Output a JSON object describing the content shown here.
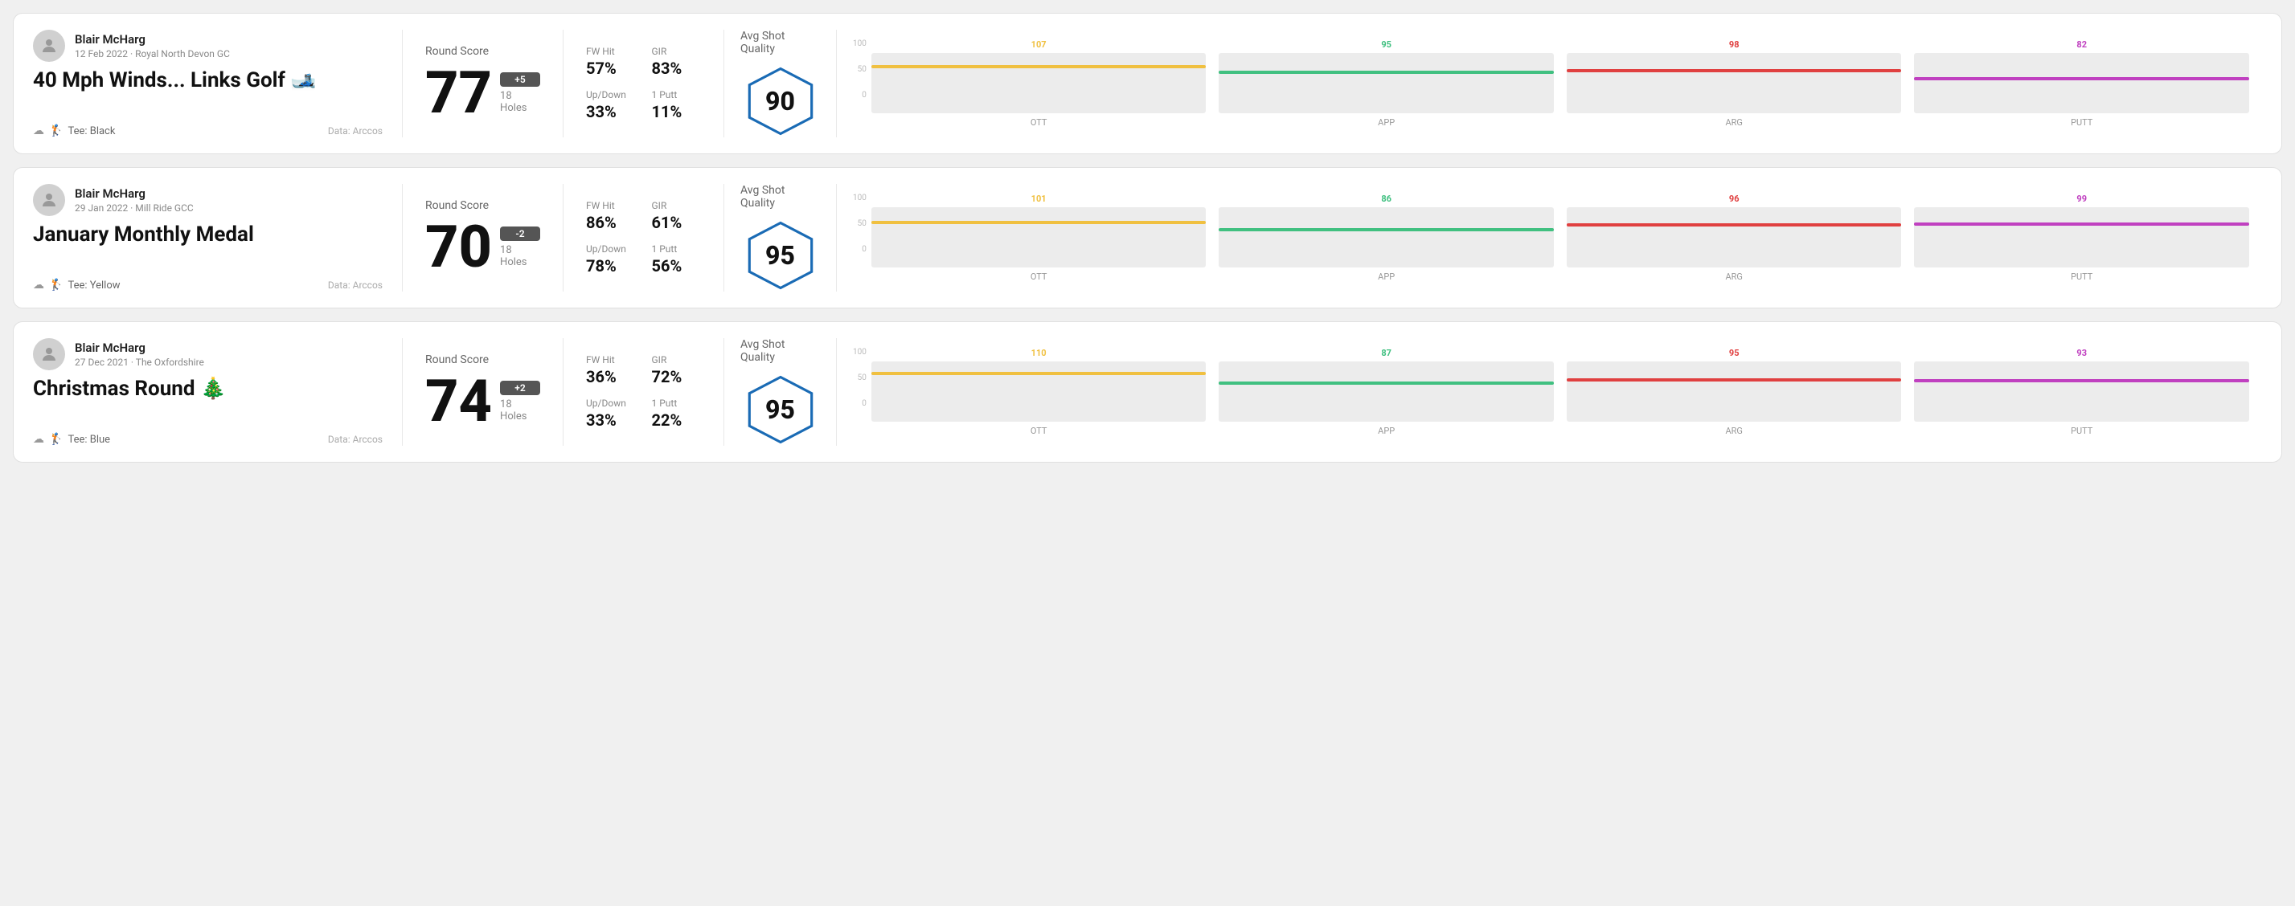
{
  "rounds": [
    {
      "id": "round-1",
      "user": {
        "name": "Blair McHarg",
        "date": "12 Feb 2022",
        "course": "Royal North Devon GC"
      },
      "title": "40 Mph Winds... Links Golf 🎿",
      "tee": "Black",
      "data_source": "Data: Arccos",
      "score": {
        "value": "77",
        "badge": "+5",
        "holes": "18 Holes"
      },
      "stats": {
        "fw_hit_label": "FW Hit",
        "fw_hit_value": "57%",
        "gir_label": "GIR",
        "gir_value": "83%",
        "updown_label": "Up/Down",
        "updown_value": "33%",
        "oneputt_label": "1 Putt",
        "oneputt_value": "11%"
      },
      "quality": {
        "label": "Avg Shot Quality",
        "score": "90"
      },
      "chart": {
        "y_labels": [
          "100",
          "50",
          "0"
        ],
        "columns": [
          {
            "label": "OTT",
            "value": 107,
            "value_label": "107",
            "color": "#f0c040",
            "bar_pct": 75
          },
          {
            "label": "APP",
            "value": 95,
            "value_label": "95",
            "color": "#40c080",
            "bar_pct": 65
          },
          {
            "label": "ARG",
            "value": 98,
            "value_label": "98",
            "color": "#e04040",
            "bar_pct": 68
          },
          {
            "label": "PUTT",
            "value": 82,
            "value_label": "82",
            "color": "#c040c0",
            "bar_pct": 55
          }
        ]
      }
    },
    {
      "id": "round-2",
      "user": {
        "name": "Blair McHarg",
        "date": "29 Jan 2022",
        "course": "Mill Ride GCC"
      },
      "title": "January Monthly Medal",
      "tee": "Yellow",
      "data_source": "Data: Arccos",
      "score": {
        "value": "70",
        "badge": "-2",
        "holes": "18 Holes"
      },
      "stats": {
        "fw_hit_label": "FW Hit",
        "fw_hit_value": "86%",
        "gir_label": "GIR",
        "gir_value": "61%",
        "updown_label": "Up/Down",
        "updown_value": "78%",
        "oneputt_label": "1 Putt",
        "oneputt_value": "56%"
      },
      "quality": {
        "label": "Avg Shot Quality",
        "score": "95"
      },
      "chart": {
        "y_labels": [
          "100",
          "50",
          "0"
        ],
        "columns": [
          {
            "label": "OTT",
            "value": 101,
            "value_label": "101",
            "color": "#f0c040",
            "bar_pct": 72
          },
          {
            "label": "APP",
            "value": 86,
            "value_label": "86",
            "color": "#40c080",
            "bar_pct": 60
          },
          {
            "label": "ARG",
            "value": 96,
            "value_label": "96",
            "color": "#e04040",
            "bar_pct": 68
          },
          {
            "label": "PUTT",
            "value": 99,
            "value_label": "99",
            "color": "#c040c0",
            "bar_pct": 70
          }
        ]
      }
    },
    {
      "id": "round-3",
      "user": {
        "name": "Blair McHarg",
        "date": "27 Dec 2021",
        "course": "The Oxfordshire"
      },
      "title": "Christmas Round 🎄",
      "tee": "Blue",
      "data_source": "Data: Arccos",
      "score": {
        "value": "74",
        "badge": "+2",
        "holes": "18 Holes"
      },
      "stats": {
        "fw_hit_label": "FW Hit",
        "fw_hit_value": "36%",
        "gir_label": "GIR",
        "gir_value": "72%",
        "updown_label": "Up/Down",
        "updown_value": "33%",
        "oneputt_label": "1 Putt",
        "oneputt_value": "22%"
      },
      "quality": {
        "label": "Avg Shot Quality",
        "score": "95"
      },
      "chart": {
        "y_labels": [
          "100",
          "50",
          "0"
        ],
        "columns": [
          {
            "label": "OTT",
            "value": 110,
            "value_label": "110",
            "color": "#f0c040",
            "bar_pct": 78
          },
          {
            "label": "APP",
            "value": 87,
            "value_label": "87",
            "color": "#40c080",
            "bar_pct": 61
          },
          {
            "label": "ARG",
            "value": 95,
            "value_label": "95",
            "color": "#e04040",
            "bar_pct": 67
          },
          {
            "label": "PUTT",
            "value": 93,
            "value_label": "93",
            "color": "#c040c0",
            "bar_pct": 66
          }
        ]
      }
    }
  ]
}
